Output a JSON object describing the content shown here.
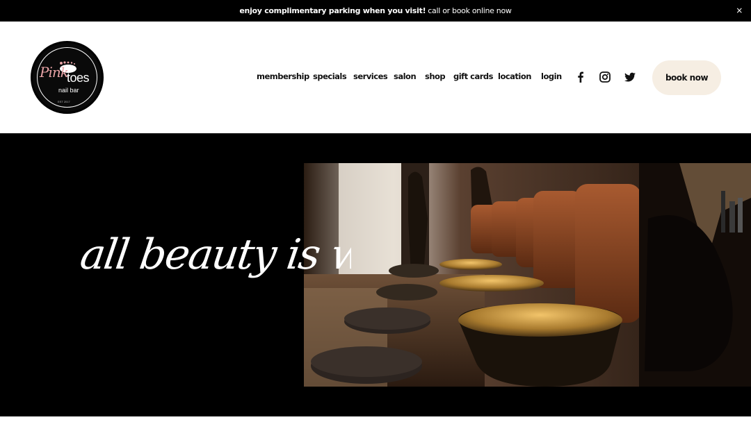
{
  "announcement": {
    "bold_text": "enjoy complimentary parking when you visit!",
    "text": "call or book online now",
    "close_label": "×"
  },
  "logo": {
    "brand_pink": "Pink",
    "brand_toes": "toes",
    "subtitle": "nail bar",
    "est": "EST 2017"
  },
  "nav": {
    "items": [
      "membership",
      "specials",
      "services",
      "salon",
      "shop",
      "gift cards",
      "location",
      "login"
    ]
  },
  "social": {
    "icons": [
      "facebook-icon",
      "instagram-icon",
      "twitter-icon"
    ]
  },
  "book_button": {
    "label": "book now"
  },
  "hero": {
    "tagline": "all beauty is welcome",
    "photo_alt": "pedicure salon interior with brown leather chairs and copper basins"
  },
  "colors": {
    "black": "#000000",
    "button_bg": "#f6eee3",
    "brand_pink": "#e8a3a6",
    "copper": "#b8863b",
    "leather": "#8a4a26"
  }
}
